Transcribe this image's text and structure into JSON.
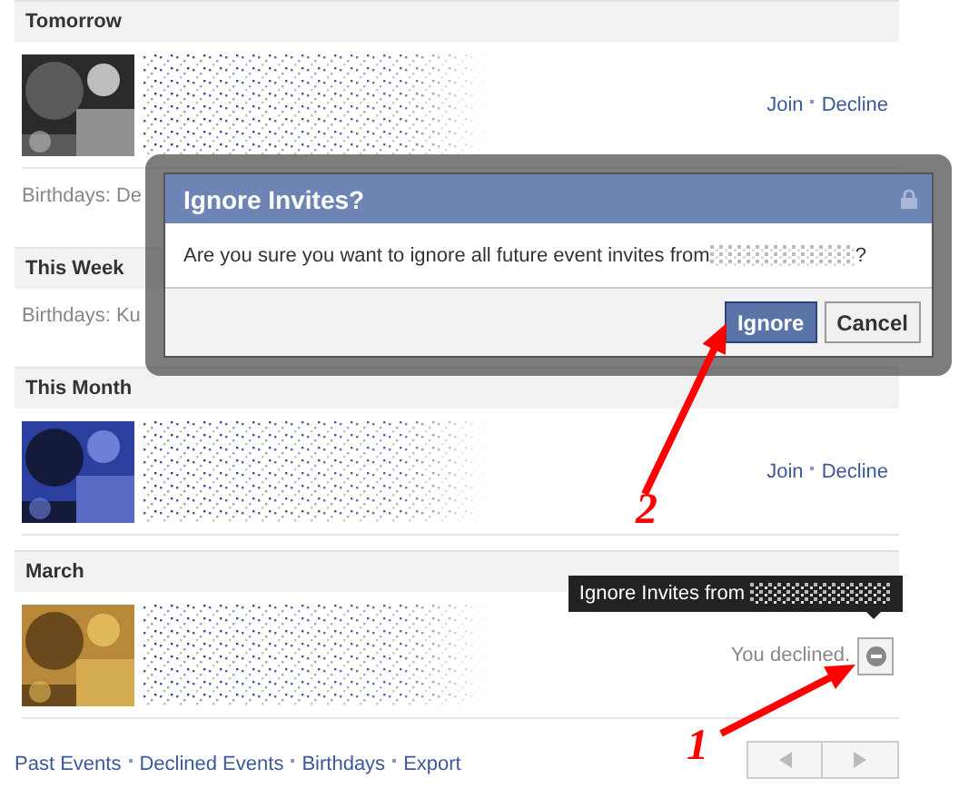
{
  "sections": [
    {
      "title": "Tomorrow",
      "items": [
        {
          "kind": "event",
          "actions": [
            "Join",
            "Decline"
          ]
        },
        {
          "kind": "birthdays",
          "text": "Birthdays: De"
        }
      ]
    },
    {
      "title": "This Week",
      "items": [
        {
          "kind": "birthdays",
          "text": "Birthdays: Ku"
        }
      ]
    },
    {
      "title": "This Month",
      "items": [
        {
          "kind": "event",
          "actions": [
            "Join",
            "Decline"
          ]
        }
      ]
    },
    {
      "title": "March",
      "items": [
        {
          "kind": "event",
          "status": "You declined.",
          "tooltip": "Ignore Invites from"
        }
      ]
    }
  ],
  "footer_links": [
    "Past Events",
    "Declined Events",
    "Birthdays",
    "Export"
  ],
  "dialog": {
    "title": "Ignore Invites?",
    "message": "Are you sure you want to ignore all future event invites from",
    "message_end": "?",
    "buttons": [
      {
        "label": "Ignore",
        "primary": true
      },
      {
        "label": "Cancel",
        "primary": false
      }
    ]
  },
  "annotations": [
    {
      "label": "2"
    },
    {
      "label": "1"
    }
  ]
}
